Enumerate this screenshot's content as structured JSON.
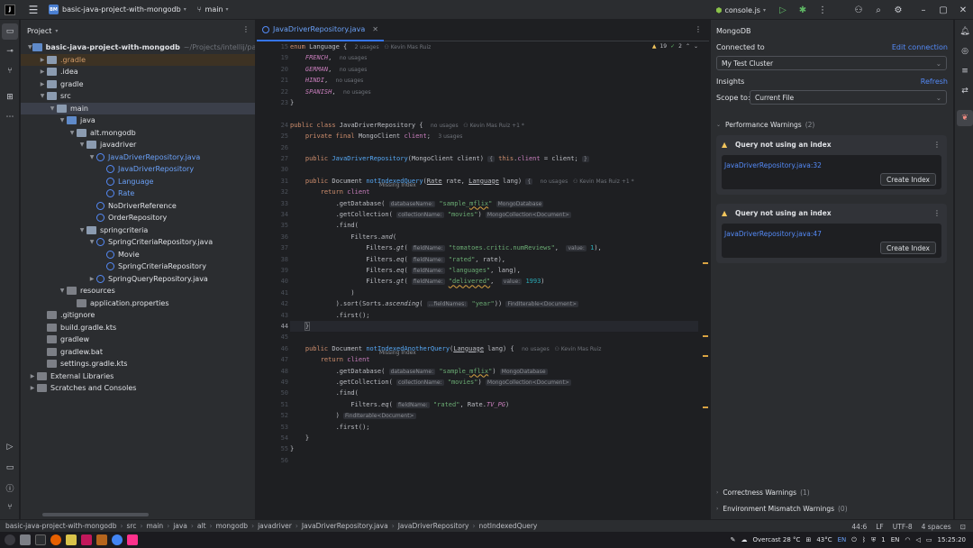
{
  "titlebar": {
    "project_badge": "BM",
    "project_name": "basic-java-project-with-mongodb",
    "branch": "main",
    "run_config": "console.js"
  },
  "project_panel": {
    "title": "Project",
    "tree": [
      {
        "label": "basic-java-project-with-mongodb",
        "extra": "~/Projects/intellij/packages/jetb",
        "depth": 0,
        "arrow": "open",
        "icon": "fold-blue"
      },
      {
        "label": ".gradle",
        "depth": 1,
        "arrow": "closed",
        "icon": "folder",
        "style": "excluded"
      },
      {
        "label": ".idea",
        "depth": 1,
        "arrow": "closed",
        "icon": "folder"
      },
      {
        "label": "gradle",
        "depth": 1,
        "arrow": "closed",
        "icon": "folder"
      },
      {
        "label": "src",
        "depth": 1,
        "arrow": "open",
        "icon": "folder"
      },
      {
        "label": "main",
        "depth": 2,
        "arrow": "open",
        "icon": "folder",
        "style": "sel"
      },
      {
        "label": "java",
        "depth": 3,
        "arrow": "open",
        "icon": "fold-blue"
      },
      {
        "label": "alt.mongodb",
        "depth": 4,
        "arrow": "open",
        "icon": "folder"
      },
      {
        "label": "javadriver",
        "depth": 5,
        "arrow": "open",
        "icon": "folder"
      },
      {
        "label": "JavaDriverRepository.java",
        "depth": 6,
        "arrow": "open",
        "icon": "cls",
        "style": "blue"
      },
      {
        "label": "JavaDriverRepository",
        "depth": 7,
        "icon": "cls",
        "style": "blue"
      },
      {
        "label": "Language",
        "depth": 7,
        "icon": "cls",
        "style": "blue"
      },
      {
        "label": "Rate",
        "depth": 7,
        "icon": "cls",
        "style": "blue"
      },
      {
        "label": "NoDriverReference",
        "depth": 6,
        "icon": "cls"
      },
      {
        "label": "OrderRepository",
        "depth": 6,
        "icon": "cls"
      },
      {
        "label": "springcriteria",
        "depth": 5,
        "arrow": "open",
        "icon": "folder"
      },
      {
        "label": "SpringCriteriaRepository.java",
        "depth": 6,
        "arrow": "open",
        "icon": "cls"
      },
      {
        "label": "Movie",
        "depth": 7,
        "icon": "cls"
      },
      {
        "label": "SpringCriteriaRepository",
        "depth": 7,
        "icon": "cls"
      },
      {
        "label": "SpringQueryRepository.java",
        "depth": 6,
        "arrow": "closed",
        "icon": "cls"
      },
      {
        "label": "resources",
        "depth": 3,
        "arrow": "open",
        "icon": "fold-gray"
      },
      {
        "label": "application.properties",
        "depth": 4,
        "icon": "file-ic"
      },
      {
        "label": ".gitignore",
        "depth": 1,
        "icon": "file-ic"
      },
      {
        "label": "build.gradle.kts",
        "depth": 1,
        "icon": "file-ic"
      },
      {
        "label": "gradlew",
        "depth": 1,
        "icon": "file-ic"
      },
      {
        "label": "gradlew.bat",
        "depth": 1,
        "icon": "file-ic"
      },
      {
        "label": "settings.gradle.kts",
        "depth": 1,
        "icon": "file-ic"
      },
      {
        "label": "External Libraries",
        "depth": 0,
        "arrow": "closed",
        "icon": "fold-gray"
      },
      {
        "label": "Scratches and Consoles",
        "depth": 0,
        "arrow": "closed",
        "icon": "fold-gray"
      }
    ]
  },
  "editor": {
    "tab_label": "JavaDriverRepository.java",
    "warnings_count": "19",
    "ok_count": "2",
    "missing_index_label": "Missing Index",
    "line_numbers": [
      "15",
      "19",
      "20",
      "21",
      "22",
      "23",
      "24",
      "25",
      "26",
      "27",
      "30",
      "31",
      "32",
      "33",
      "34",
      "35",
      "36",
      "37",
      "38",
      "39",
      "40",
      "41",
      "42",
      "43",
      "44",
      "45",
      "46",
      "47",
      "48",
      "49",
      "50",
      "51",
      "52",
      "53",
      "54",
      "55",
      "56"
    ]
  },
  "mongodb_panel": {
    "title": "MongoDB",
    "connected_label": "Connected to",
    "edit_connection": "Edit connection",
    "cluster": "My Test Cluster",
    "insights_label": "Insights",
    "refresh": "Refresh",
    "scope_label": "Scope to:",
    "scope_value": "Current File",
    "perf_label": "Performance Warnings",
    "perf_count": "(2)",
    "warnings": [
      {
        "title": "Query not using an index",
        "link": "JavaDriverRepository.java:32",
        "button": "Create Index"
      },
      {
        "title": "Query not using an index",
        "link": "JavaDriverRepository.java:47",
        "button": "Create Index"
      }
    ],
    "correctness_label": "Correctness Warnings",
    "correctness_count": "(1)",
    "env_label": "Environment Mismatch Warnings",
    "env_count": "(0)"
  },
  "statusbar": {
    "breadcrumb": [
      "basic-java-project-with-mongodb",
      "src",
      "main",
      "java",
      "alt",
      "mongodb",
      "javadriver",
      "JavaDriverRepository.java",
      "JavaDriverRepository",
      "notIndexedQuery"
    ],
    "position": "44:6",
    "line_sep": "LF",
    "encoding": "UTF-8",
    "indent": "4 spaces"
  },
  "taskbar": {
    "weather": "Overcast 28 °C",
    "cpu_temp": "43°C",
    "lang": "EN",
    "workspace": "1",
    "lang2": "EN",
    "time": "15:25:20"
  }
}
